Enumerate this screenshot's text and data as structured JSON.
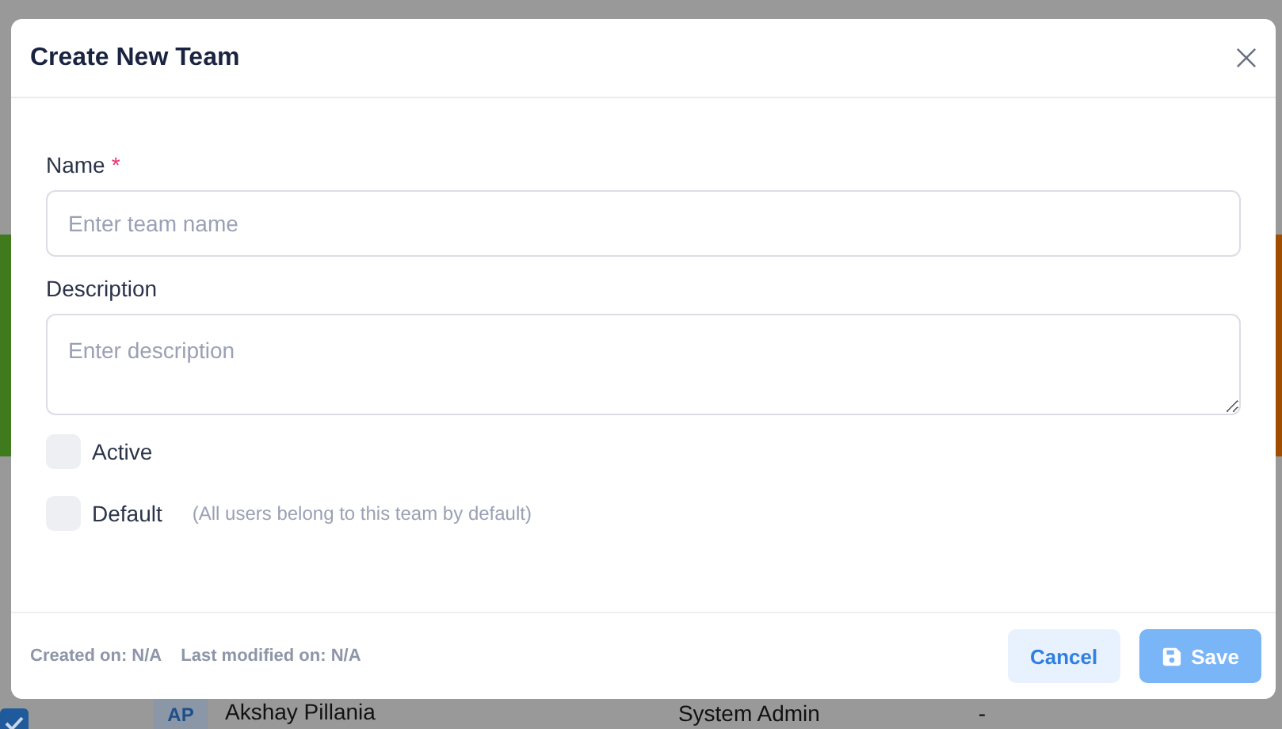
{
  "background": {
    "rows": [
      {
        "checked": true,
        "avatar": "AP",
        "name": "Akshay Pillania",
        "role": "System Admin",
        "column_4": "-"
      }
    ]
  },
  "dialog": {
    "title": "Create New Team",
    "fields": [
      {
        "kind": "input",
        "label": "Name",
        "required_mark": "*",
        "placeholder": "Enter team name"
      },
      {
        "kind": "textarea",
        "label": "Description",
        "placeholder": "Enter description"
      }
    ],
    "options": [
      {
        "label": "Active",
        "checked": false
      },
      {
        "label": "Default",
        "checked": false,
        "hint": "(All users belong to this team by default)"
      }
    ],
    "footer": {
      "created": "Created on: N/A",
      "modified": "Last modified on: N/A"
    },
    "buttons": [
      {
        "kind": "secondary",
        "label": "Cancel",
        "disabled": false
      },
      {
        "kind": "primary",
        "label": "Save",
        "disabled": true
      }
    ]
  }
}
